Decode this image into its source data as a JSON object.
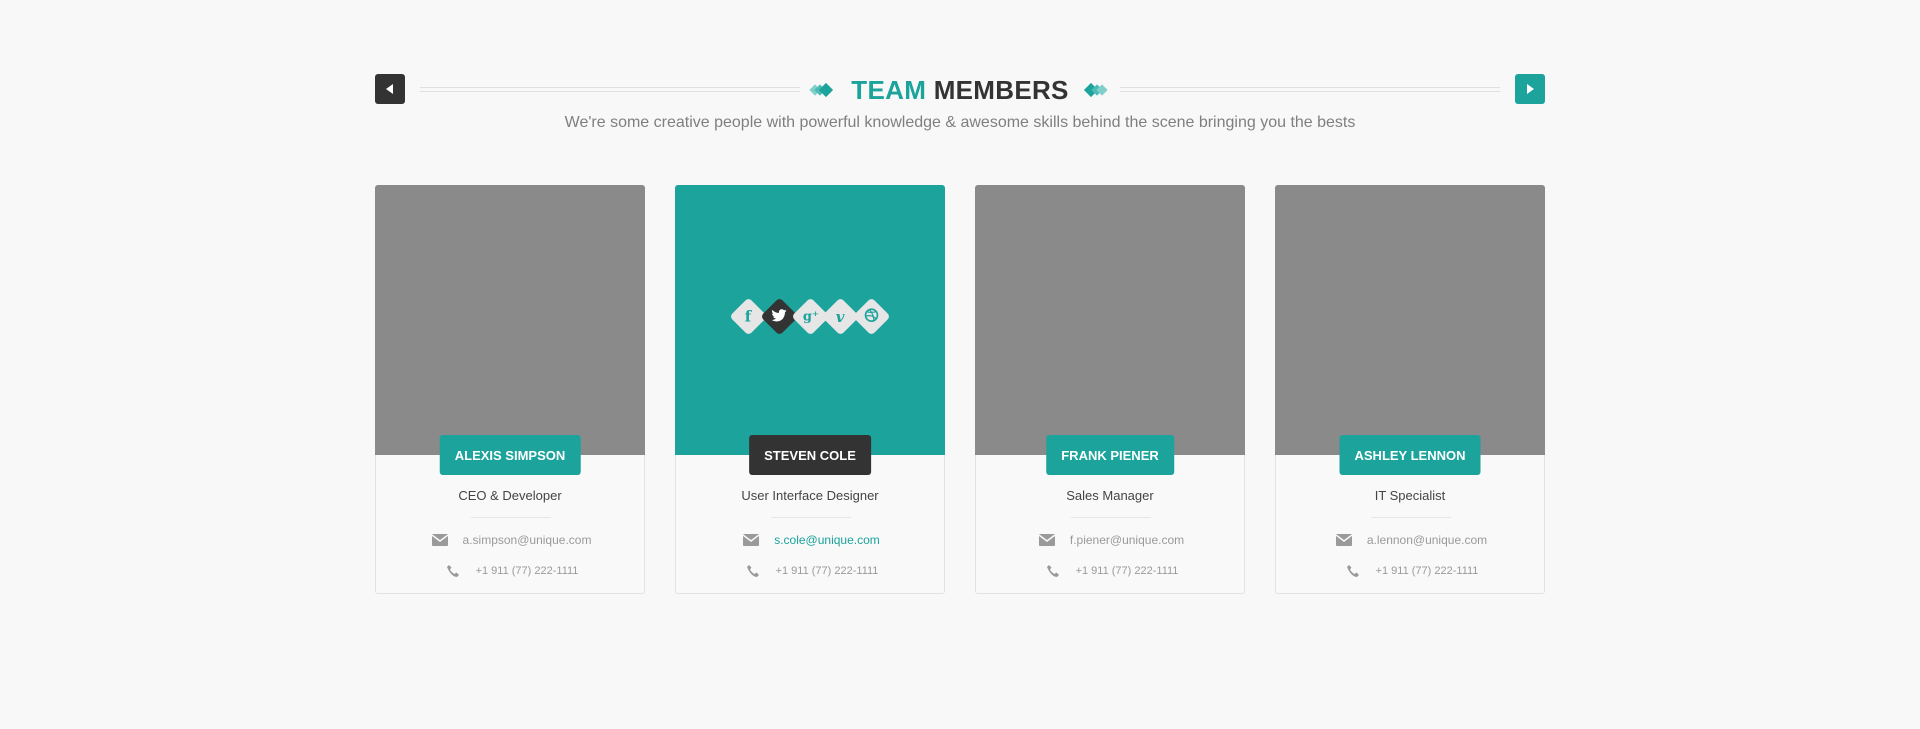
{
  "header": {
    "title_accent": "TEAM",
    "title_rest": "MEMBERS",
    "subtitle": "We're some creative people with powerful knowledge & awesome skills behind the scene bringing you the bests",
    "prev_icon": "arrow-left-icon",
    "next_icon": "arrow-right-icon"
  },
  "colors": {
    "accent": "#1ba39c",
    "dark": "#333333",
    "photo_placeholder": "#8a8a8a",
    "background": "#f8f8f8"
  },
  "members": [
    {
      "name": "ALEXIS SIMPSON",
      "role": "CEO & Developer",
      "email": "a.simpson@unique.com",
      "phone": "+1 911 (77) 222-1111"
    },
    {
      "name": "STEVEN COLE",
      "role": "User Interface Designer",
      "email": "s.cole@unique.com",
      "phone": "+1 911 (77) 222-1111"
    },
    {
      "name": "FRANK PIENER",
      "role": "Sales Manager",
      "email": "f.piener@unique.com",
      "phone": "+1 911 (77) 222-1111"
    },
    {
      "name": "ASHLEY LENNON",
      "role": "IT Specialist",
      "email": "a.lennon@unique.com",
      "phone": "+1 911 (77) 222-1111"
    }
  ],
  "socials": {
    "facebook": "f",
    "google_plus": "g⁺",
    "vimeo": "v",
    "icons": [
      "facebook-icon",
      "twitter-icon",
      "google-plus-icon",
      "vimeo-icon",
      "dribbble-icon"
    ]
  }
}
